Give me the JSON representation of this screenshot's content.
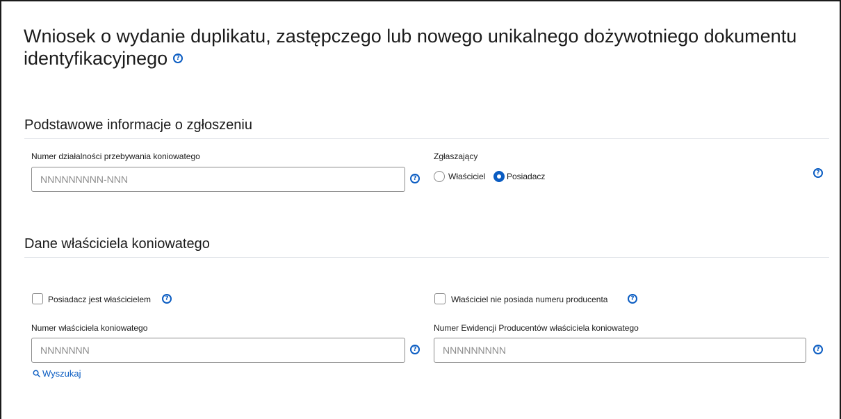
{
  "title": "Wniosek o wydanie duplikatu, zastępczego lub nowego unikalnego dożywotniego dokumentu identyfikacyjnego",
  "help_icon_glyph": "?",
  "section_basic": {
    "title": "Podstawowe informacje o zgłoszeniu",
    "activity_number": {
      "label": "Numer działalności przebywania koniowatego",
      "placeholder": "NNNNNNNNN-NNN",
      "value": ""
    },
    "reporter": {
      "label": "Zgłaszający",
      "options": [
        "Właściciel",
        "Posiadacz"
      ],
      "selected": "Posiadacz"
    }
  },
  "section_owner": {
    "title": "Dane właściciela koniowatego",
    "holder_is_owner": {
      "label": "Posiadacz jest właścicielem",
      "checked": false
    },
    "owner_no_producer_number": {
      "label": "Właściciel nie posiada numeru producenta",
      "checked": false
    },
    "owner_number": {
      "label": "Numer właściciela koniowatego",
      "placeholder": "NNNNNNN",
      "value": ""
    },
    "producer_number": {
      "label": "Numer Ewidencji Producentów właściciela koniowatego",
      "placeholder": "NNNNNNNNN",
      "value": ""
    },
    "search_link": "Wyszukaj"
  },
  "colors": {
    "accent": "#0a5cc2",
    "text": "#1b1b1b",
    "border": "#8a8a8a",
    "divider": "#e3e6ea"
  },
  "icons": [
    "help-icon",
    "search-icon",
    "radio-icon",
    "checkbox-icon"
  ]
}
